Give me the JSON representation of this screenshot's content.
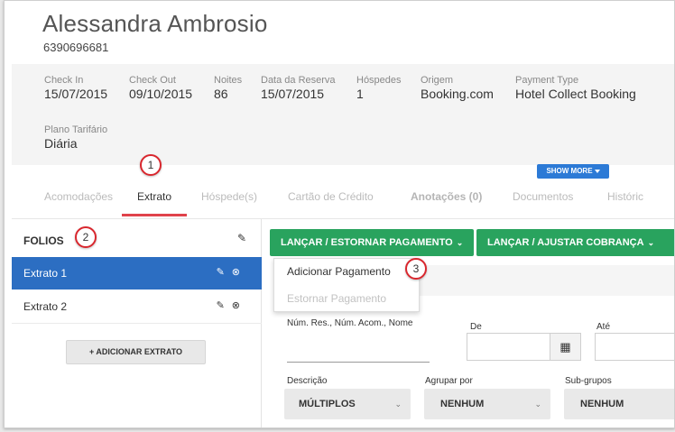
{
  "guest": {
    "name": "Alessandra Ambrosio",
    "booking_id": "6390696681"
  },
  "reservation": {
    "check_in_label": "Check In",
    "check_in": "15/07/2015",
    "check_out_label": "Check Out",
    "check_out": "09/10/2015",
    "nights_label": "Noites",
    "nights": "86",
    "booking_date_label": "Data da Reserva",
    "booking_date": "15/07/2015",
    "guests_label": "Hóspedes",
    "guests": "1",
    "origin_label": "Origem",
    "origin": "Booking.com",
    "payment_type_label": "Payment Type",
    "payment_type": "Hotel Collect Booking",
    "rate_plan_label": "Plano Tarifário",
    "rate_plan": "Diária",
    "show_more": "SHOW MORE"
  },
  "tabs": [
    {
      "label": "Acomodações"
    },
    {
      "label": "Extrato"
    },
    {
      "label": "Hóspede(s)"
    },
    {
      "label": "Cartão de Crédito"
    },
    {
      "label": "Anotações (0)"
    },
    {
      "label": "Documentos"
    },
    {
      "label": "Históric"
    }
  ],
  "callouts": [
    "1",
    "2",
    "3"
  ],
  "folios": {
    "title": "FOLIOS",
    "items": [
      {
        "label": "Extrato 1"
      },
      {
        "label": "Extrato 2"
      }
    ],
    "add_label": "ADICIONAR EXTRATO"
  },
  "actions": {
    "payment_button": "LANÇAR / ESTORNAR PAGAMENTO",
    "charge_button": "LANÇAR / AJUSTAR COBRANÇA",
    "payment_menu": [
      "Adicionar Pagamento",
      "Estornar Pagamento"
    ]
  },
  "filters": {
    "search_label": "Núm. Res., Núm. Acom., Nome",
    "from_label": "De",
    "to_label": "Até",
    "description_label": "Descrição",
    "description_value": "MÚLTIPLOS",
    "group_by_label": "Agrupar por",
    "group_by_value": "NENHUM",
    "subgroups_label": "Sub-grupos",
    "subgroups_value": "NENHUM"
  },
  "colors": {
    "accent_blue": "#2c6ec2",
    "action_green": "#29a35e",
    "active_tab_underline": "#e0424b",
    "callout_ring": "#d9272e"
  },
  "icons": [
    "pencil-icon",
    "close-circle-icon",
    "plus-icon",
    "calendar-icon",
    "chevron-down-icon",
    "caret-down-icon"
  ]
}
